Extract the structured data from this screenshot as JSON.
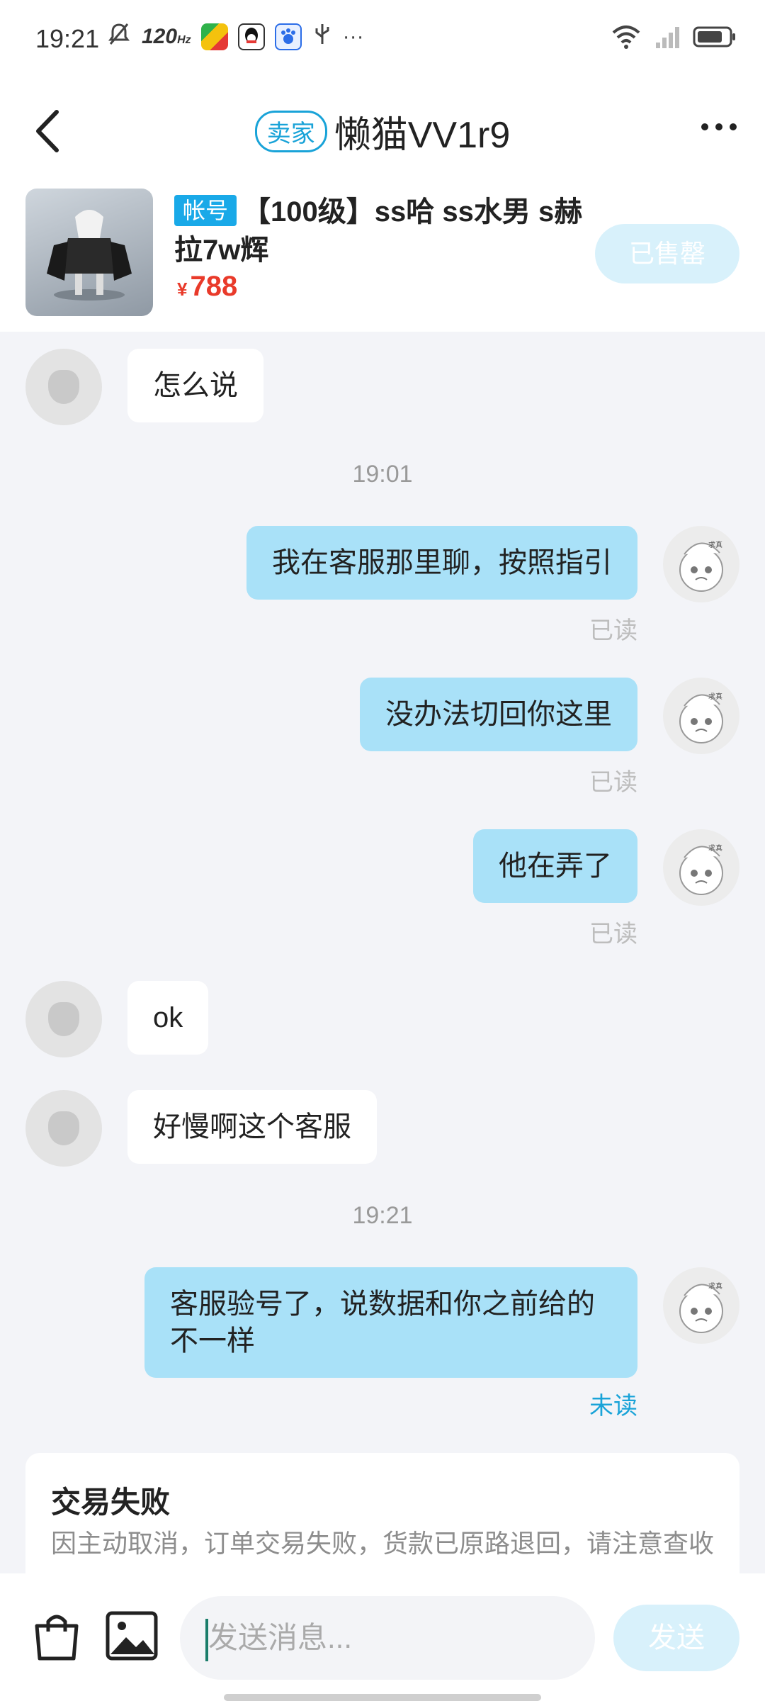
{
  "status_bar": {
    "time": "19:21",
    "refresh": "120",
    "refresh_unit": "Hz",
    "more": "···"
  },
  "header": {
    "seller_tag": "卖家",
    "title": "懒猫VV1r9"
  },
  "product": {
    "account_tag": "帐号",
    "title": "【100级】ss哈 ss水男 s赫拉7w辉",
    "currency": "¥",
    "price": "788",
    "sold_label": "已售罄"
  },
  "messages": [
    {
      "from": "seller",
      "text": "怎么说"
    },
    {
      "type": "time",
      "text": "19:01"
    },
    {
      "from": "me",
      "text": "我在客服那里聊，按照指引",
      "status": "已读"
    },
    {
      "from": "me",
      "text": "没办法切回你这里",
      "status": "已读"
    },
    {
      "from": "me",
      "text": "他在弄了",
      "status": "已读"
    },
    {
      "from": "seller",
      "text": "ok"
    },
    {
      "from": "seller",
      "text": "好慢啊这个客服"
    },
    {
      "type": "time",
      "text": "19:21"
    },
    {
      "from": "me",
      "text": "客服验号了，说数据和你之前给的不一样",
      "status": "未读"
    }
  ],
  "fail_card": {
    "title": "交易失败",
    "text": "因主动取消，订单交易失败，货款已原路退回，请注意查收"
  },
  "input": {
    "placeholder": "发送消息..."
  },
  "send_label": "发送",
  "colors": {
    "accent": "#19a3d8",
    "my_bubble": "#a9e1f8",
    "price": "#e93a2a",
    "disabled_button": "#d8f1fb"
  }
}
